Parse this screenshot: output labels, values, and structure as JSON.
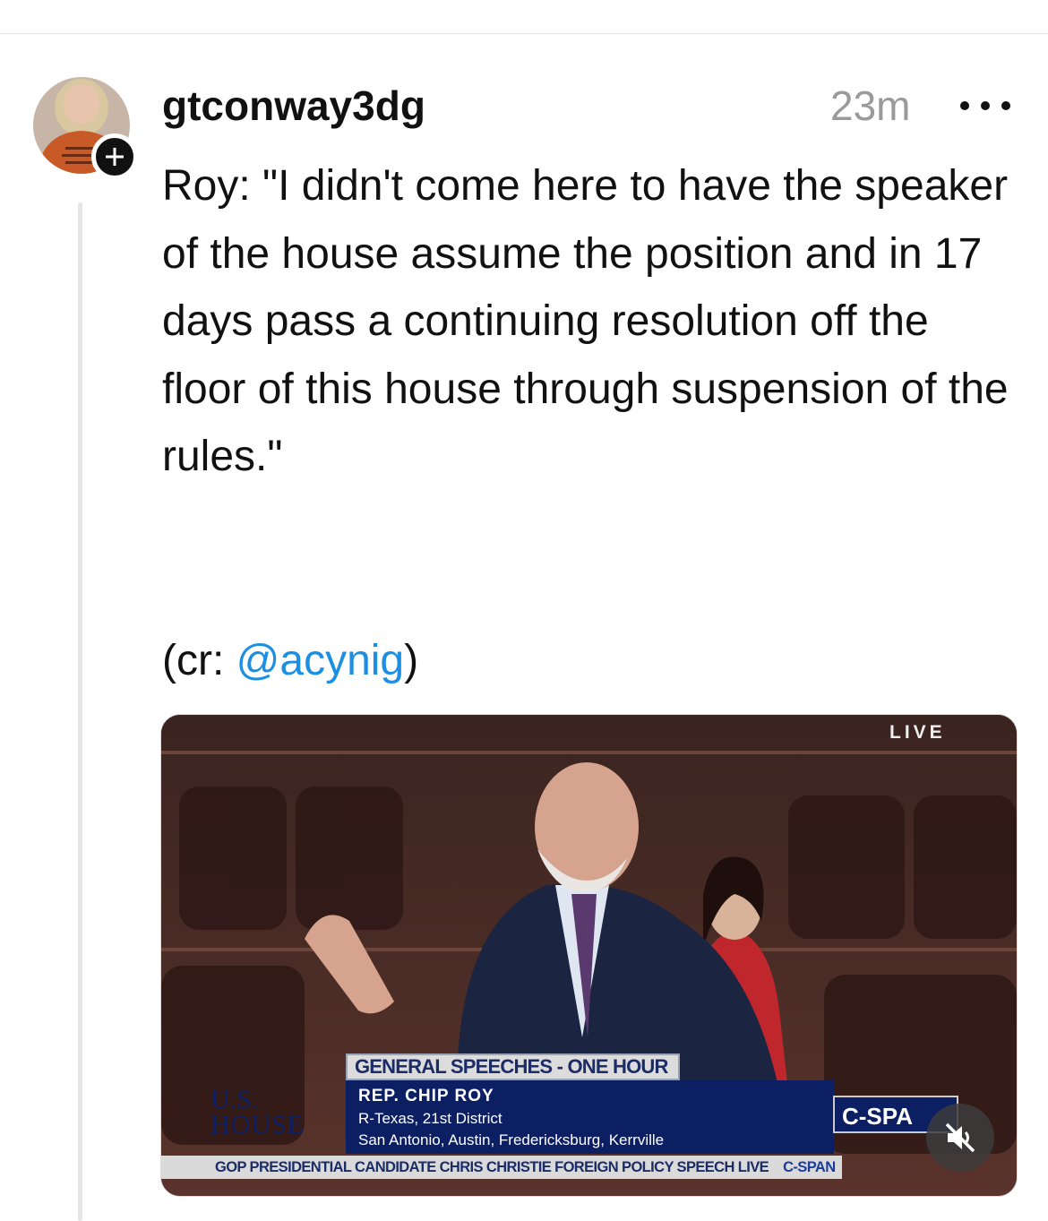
{
  "post": {
    "username": "gtconway3dg",
    "time": "23m",
    "text": "Roy: \"I didn't come here to have the speaker of the house assume the position and in 17 days pass a continuing resolution off the floor of this house through suspension of the rules.\"",
    "credit_prefix": "(cr: ",
    "credit_mention": "@acynig",
    "credit_suffix": ")"
  },
  "video": {
    "live_label": "LIVE",
    "chyron_title": "GENERAL SPEECHES - ONE HOUR",
    "chyron_name": "REP. CHIP ROY",
    "chyron_district": "R-Texas, 21st District",
    "chyron_towns": "San Antonio, Austin, Fredericksburg, Kerrville",
    "logo_line1": "U.S.",
    "logo_line2": "HOUSE",
    "ticker_text": "GOP PRESIDENTIAL CANDIDATE CHRIS CHRISTIE FOREIGN POLICY SPEECH LIVE",
    "ticker_brand": "C-SPAN",
    "network_badge": "C-SPA",
    "muted": true
  },
  "icons": {
    "follow": "plus-icon",
    "more": "more-options-icon",
    "mute": "speaker-muted-icon"
  },
  "colors": {
    "mention": "#1d8fe3",
    "timestamp": "#9a9a9a",
    "chyron": "#0d1f63"
  }
}
